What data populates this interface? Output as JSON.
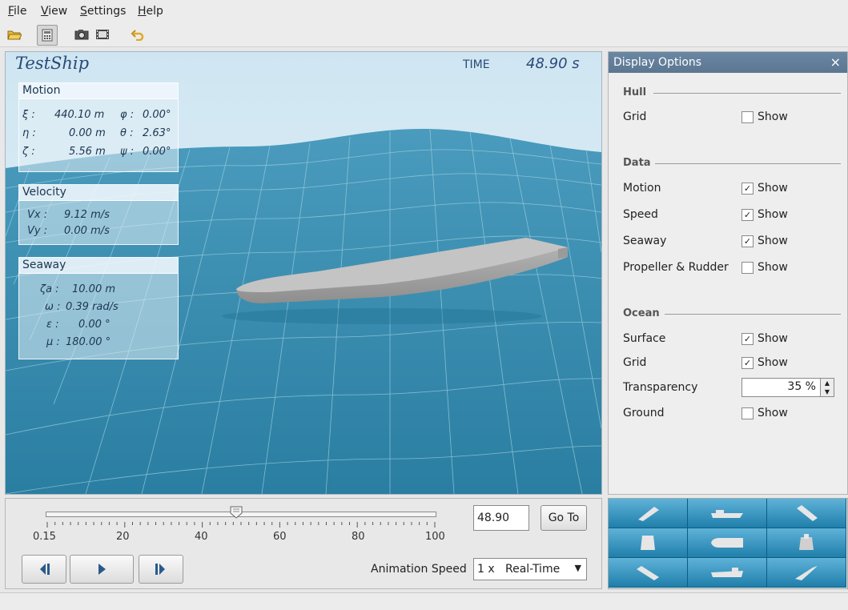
{
  "menu": {
    "file": {
      "hotkey": "F",
      "rest": "ile"
    },
    "view": {
      "hotkey": "V",
      "rest": "iew"
    },
    "settings": {
      "hotkey": "S",
      "rest": "ettings"
    },
    "help": {
      "hotkey": "H",
      "rest": "elp"
    }
  },
  "toolbar_icons": [
    "open-folder-icon",
    "calculator-icon",
    "camera-icon",
    "film-icon",
    "undo-icon"
  ],
  "viewport": {
    "title": "TestShip",
    "time_label": "TIME",
    "time_value": "48.90 s"
  },
  "motion": {
    "title": "Motion",
    "rows": [
      {
        "sym": "ξ :",
        "val": "440.10 m",
        "sym2": "φ :",
        "val2": "0.00°"
      },
      {
        "sym": "η :",
        "val": "0.00 m",
        "sym2": "θ :",
        "val2": "2.63°"
      },
      {
        "sym": "ζ :",
        "val": "5.56 m",
        "sym2": "ψ :",
        "val2": "0.00°"
      }
    ]
  },
  "velocity": {
    "title": "Velocity",
    "rows": [
      {
        "sym": "Vx :",
        "val": "9.12 m/s"
      },
      {
        "sym": "Vy :",
        "val": "0.00 m/s"
      }
    ]
  },
  "seaway": {
    "title": "Seaway",
    "rows": [
      {
        "sym": "ζa :",
        "val": "10.00   m"
      },
      {
        "sym": "ω :",
        "val": "0.39 rad/s"
      },
      {
        "sym": "ε :",
        "val": "0.00 °"
      },
      {
        "sym": "μ :",
        "val": "180.00 °"
      }
    ]
  },
  "display_options": {
    "title": "Display Options",
    "close": "×",
    "show_label": "Show",
    "hull": {
      "title": "Hull",
      "grid": {
        "label": "Grid",
        "checked": false
      }
    },
    "data": {
      "title": "Data",
      "motion": {
        "label": "Motion",
        "checked": true
      },
      "speed": {
        "label": "Speed",
        "checked": true
      },
      "seaway": {
        "label": "Seaway",
        "checked": true
      },
      "propeller": {
        "label": "Propeller & Rudder",
        "checked": false
      }
    },
    "ocean": {
      "title": "Ocean",
      "surface": {
        "label": "Surface",
        "checked": true
      },
      "grid": {
        "label": "Grid",
        "checked": true
      },
      "transparency": {
        "label": "Transparency",
        "value": "35 %"
      },
      "ground": {
        "label": "Ground",
        "checked": false
      }
    },
    "check_mark": "✓"
  },
  "timeline": {
    "ticks": [
      "0.15",
      "20",
      "40",
      "60",
      "80",
      "100"
    ],
    "position_fraction": 0.489,
    "time_input": "48.90",
    "goto_label": "Go To",
    "animation_speed_label": "Animation Speed",
    "animation_speed_value": "1 x   Real-Time"
  },
  "view_buttons": [
    "view-bow-oblique",
    "view-side",
    "view-stern-oblique",
    "view-front",
    "view-top",
    "view-back",
    "view-bow-low",
    "view-side-low",
    "view-stern-low"
  ],
  "colors": {
    "sea_top": "#3f93b5",
    "sea_bottom": "#2a7fa0",
    "sky": "#dcedf5",
    "hull": "#a8a8a8",
    "accent": "#5b7691"
  }
}
